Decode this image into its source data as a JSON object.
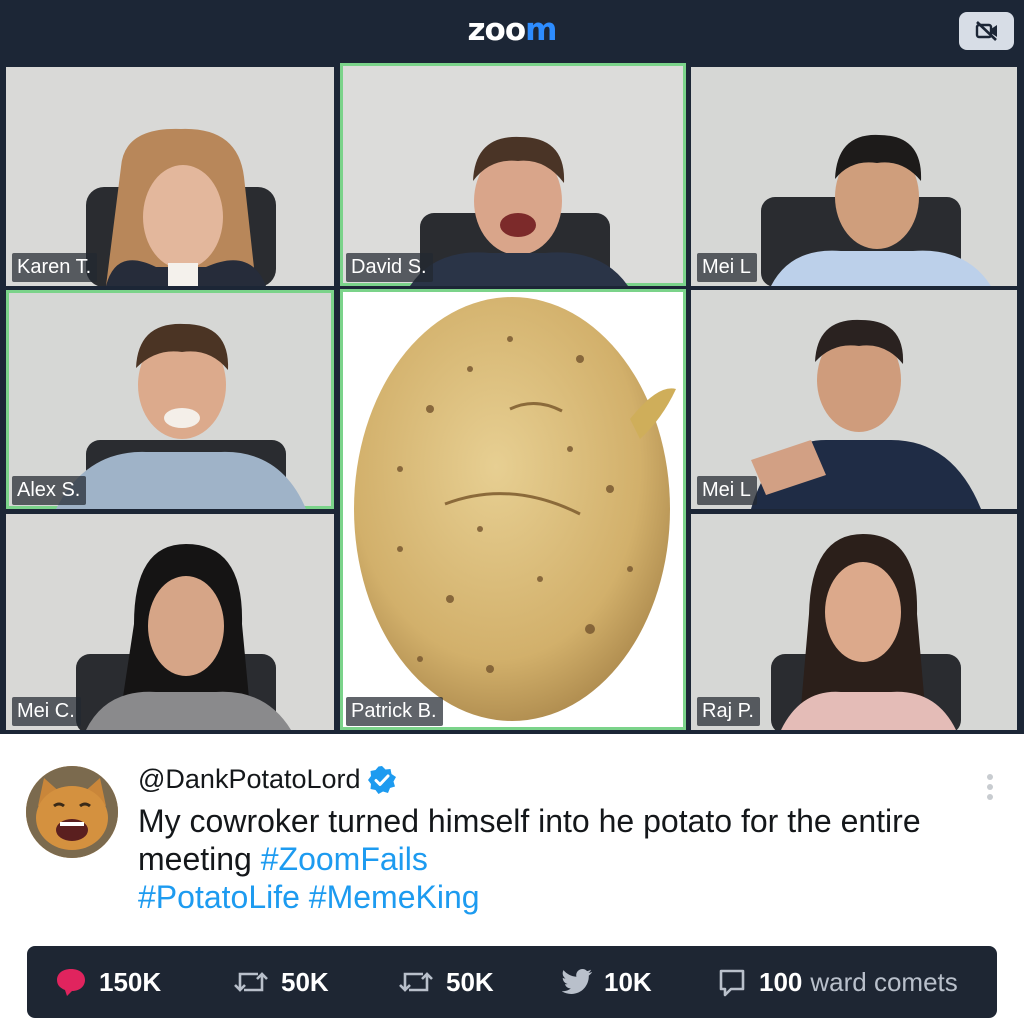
{
  "app": {
    "logo_main": "zoo",
    "logo_accent": "m"
  },
  "header": {
    "icon": "video-off-icon"
  },
  "participants": [
    {
      "name": "Karen T.",
      "active": false
    },
    {
      "name": "David S.",
      "active": true
    },
    {
      "name": "Mei L",
      "active": false
    },
    {
      "name": "Alex S.",
      "active": true
    },
    {
      "name": "Patrick B.",
      "active": true,
      "is_potato": true
    },
    {
      "name": "Mei L",
      "active": false
    },
    {
      "name": "Mei C.",
      "active": false
    },
    {
      "name": "Raj P.",
      "active": false
    }
  ],
  "tweet": {
    "handle": "@DankPotatoLord",
    "verified": true,
    "text_plain": "My cowroker turned himself into he potato for the entire meeting",
    "hashtag_1": "#ZoomFails",
    "hashtag_2": "#PotatoLife",
    "hashtag_3": "#MemeKing",
    "actions": {
      "likes": "150K",
      "retweets_1": "50K",
      "retweets_2": "50K",
      "shares": "10K",
      "comments": "100",
      "comments_suffix": "ward comets"
    }
  },
  "colors": {
    "zoom_bg": "#1c2636",
    "accent": "#2d8cff",
    "hashtag": "#1d9bf0",
    "like_red": "#e0245e",
    "active_border": "#7bd38a"
  }
}
